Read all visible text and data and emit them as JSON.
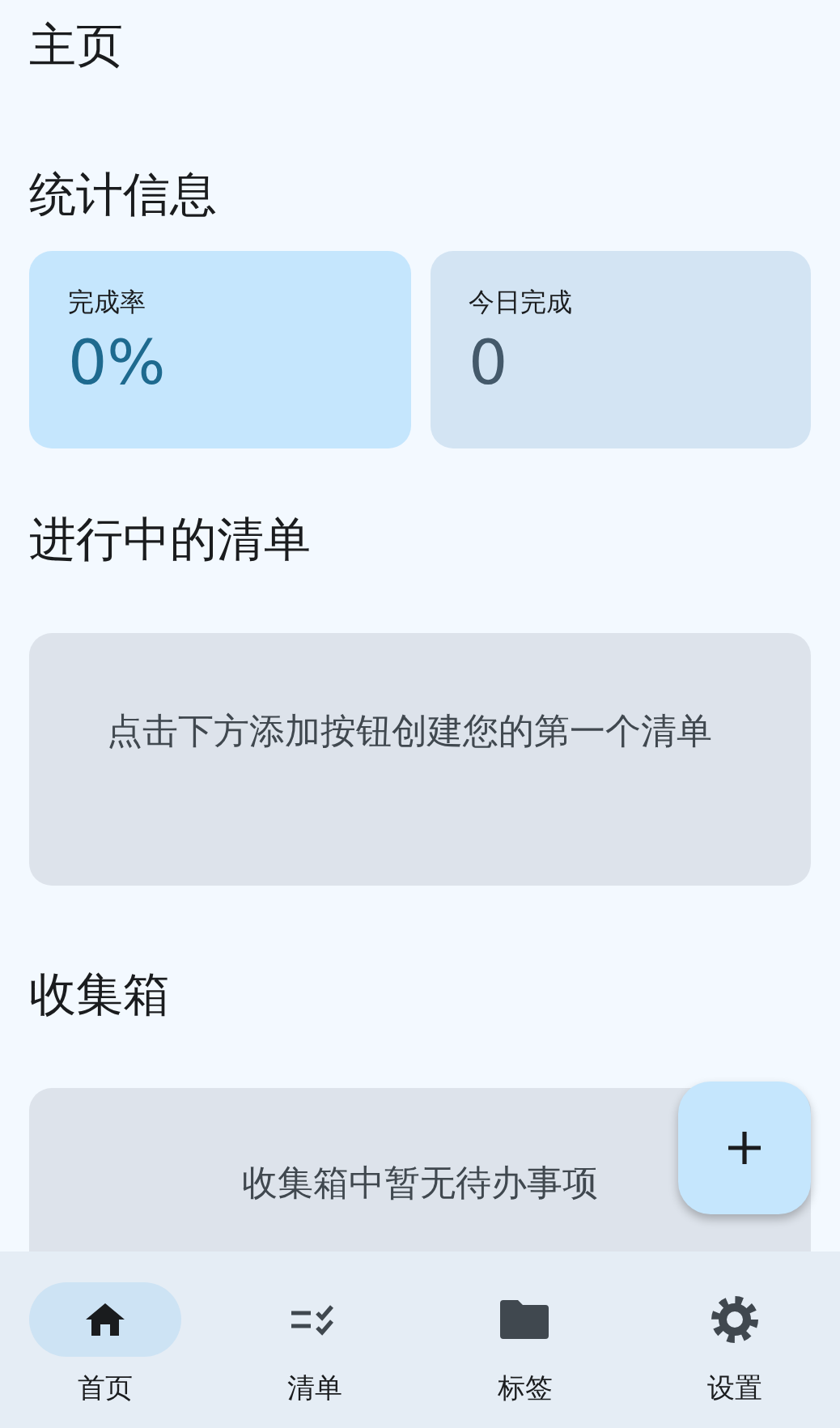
{
  "title": "主页",
  "stats": {
    "heading": "统计信息",
    "cards": [
      {
        "kind": "primary",
        "label": "完成率",
        "value": "0%"
      },
      {
        "kind": "secondary",
        "label": "今日完成",
        "value": "0"
      }
    ]
  },
  "active_lists": {
    "heading": "进行中的清单",
    "empty_text": "点击下方添加按钮创建您的第一个清单"
  },
  "inbox": {
    "heading": "收集箱",
    "empty_text": "收集箱中暂无待办事项"
  },
  "nav": [
    {
      "kind": "home",
      "label": "首页",
      "selected": true
    },
    {
      "kind": "lists",
      "label": "清单",
      "selected": false
    },
    {
      "kind": "tags",
      "label": "标签",
      "selected": false
    },
    {
      "kind": "settings",
      "label": "设置",
      "selected": false
    }
  ]
}
